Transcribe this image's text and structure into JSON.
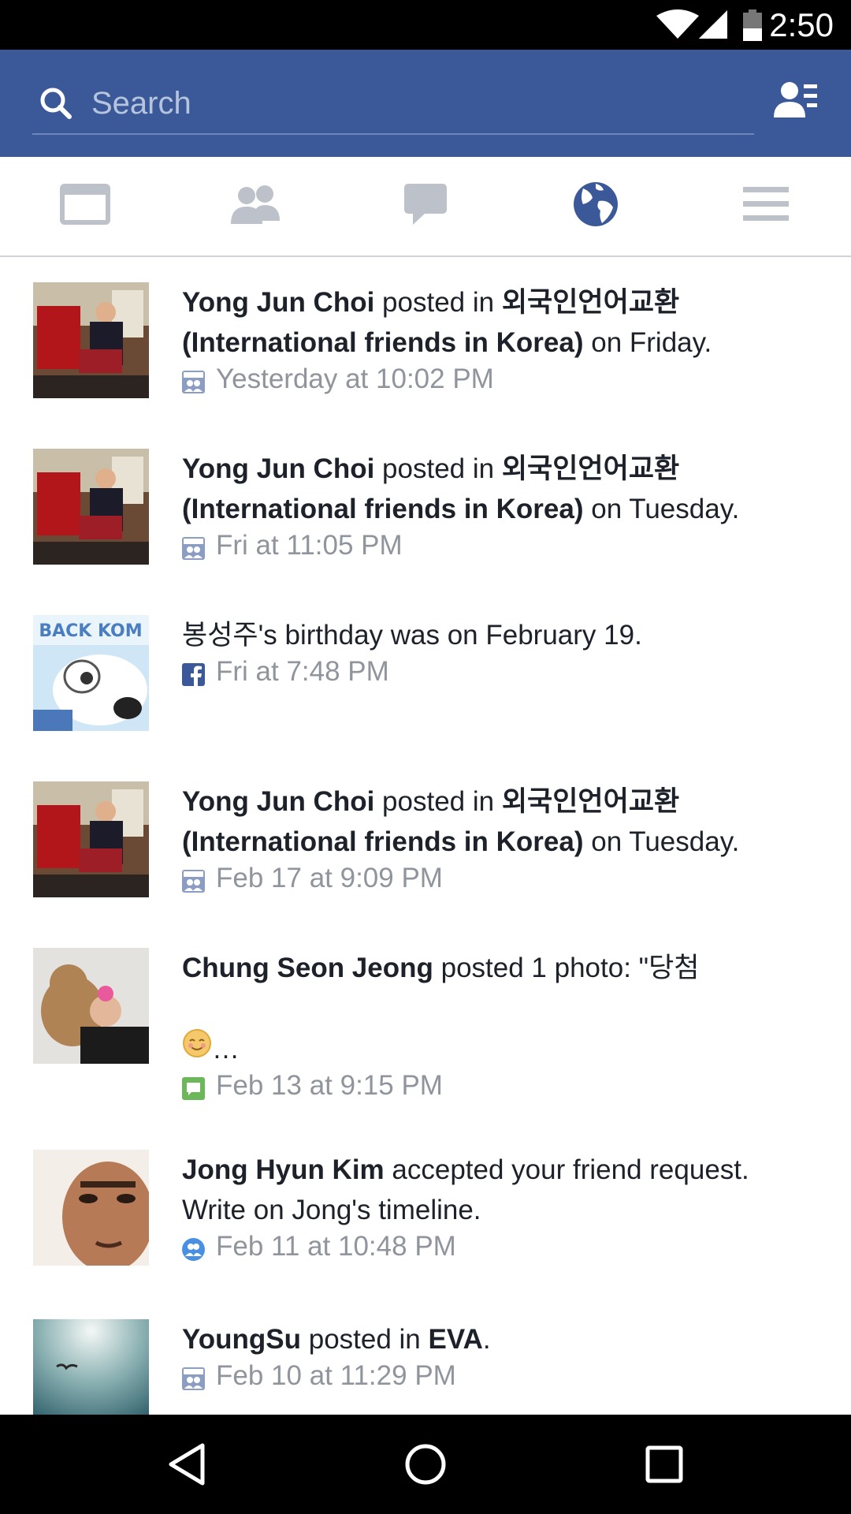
{
  "status_bar": {
    "time": "2:50",
    "icons": [
      "wifi-icon",
      "cell-signal-icon",
      "battery-icon"
    ]
  },
  "header": {
    "search_placeholder": "Search",
    "icons": [
      "search-icon",
      "friend-requests-icon"
    ]
  },
  "tabs": [
    {
      "name": "news-feed",
      "icon": "news-feed-icon",
      "active": false
    },
    {
      "name": "friends",
      "icon": "friends-icon",
      "active": false
    },
    {
      "name": "messages",
      "icon": "chat-bubble-icon",
      "active": false
    },
    {
      "name": "notifications",
      "icon": "globe-icon",
      "active": true
    },
    {
      "name": "more",
      "icon": "menu-icon",
      "active": false
    }
  ],
  "notifications": [
    {
      "actor": "Yong Jun Choi",
      "verb": " posted in ",
      "group": "외국인언어교환",
      "group_line2": "(International friends in Korea)",
      "suffix": " on Friday.",
      "meta_icon": "group-icon",
      "time": "Yesterday at 10:02 PM"
    },
    {
      "actor": "Yong Jun Choi",
      "verb": " posted in ",
      "group": "외국인언어교환",
      "group_line2": "(International friends in Korea)",
      "suffix": " on Tuesday.",
      "meta_icon": "group-icon",
      "time": "Fri at 11:05 PM"
    },
    {
      "actor": "봉성주",
      "suffix": "'s birthday was on February 19.",
      "meta_icon": "facebook-icon",
      "time": "Fri at 7:48 PM",
      "thumb_text": "BACK KOM"
    },
    {
      "actor": "Yong Jun Choi",
      "verb": " posted in ",
      "group": "외국인언어교환",
      "group_line2": "(International friends in Korea)",
      "suffix": " on Tuesday.",
      "meta_icon": "group-icon",
      "time": "Feb 17 at 9:09 PM"
    },
    {
      "actor": "Chung Seon Jeong",
      "suffix": " posted 1 photo: \"당첨",
      "line3": "…",
      "meta_icon": "comment-icon",
      "time": "Feb 13 at 9:15 PM"
    },
    {
      "actor": "Jong Hyun Kim",
      "suffix": " accepted your friend request.",
      "line2": "Write on Jong's timeline.",
      "meta_icon": "friend-icon",
      "time": "Feb 11 at 10:48 PM"
    },
    {
      "actor": "YoungSu",
      "verb": " posted in ",
      "group": "EVA",
      "suffix": ".",
      "meta_icon": "group-icon",
      "time": "Feb 10 at 11:29 PM"
    }
  ],
  "navbar": {
    "icons": [
      "back-icon",
      "home-icon",
      "recents-icon"
    ]
  },
  "colors": {
    "brand": "#3b5998",
    "meta_text": "#90949c",
    "body_text": "#1d2129",
    "active_tab": "#3b5998",
    "inactive_tab": "#bdc1c9"
  }
}
